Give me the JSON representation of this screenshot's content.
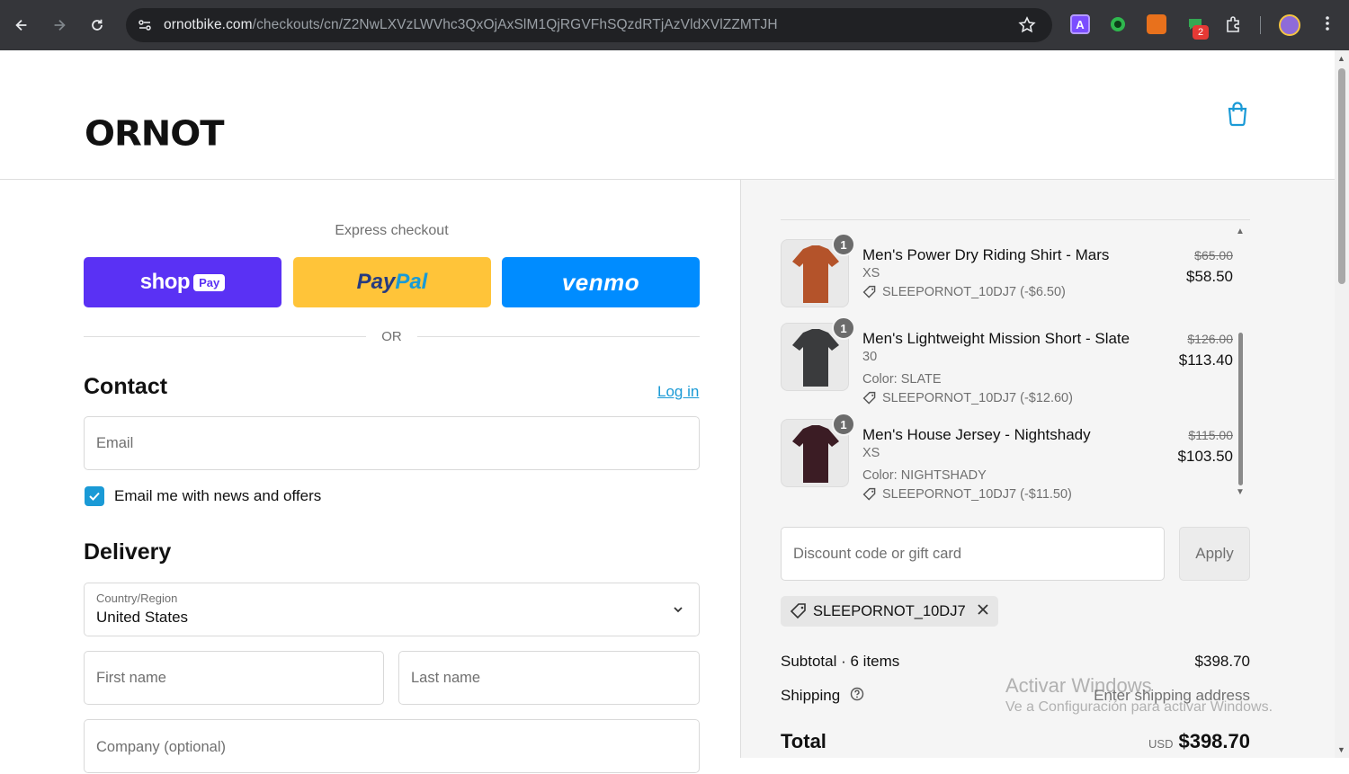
{
  "browser": {
    "url_host": "ornotbike.com",
    "url_path": "/checkouts/cn/Z2NwLXVzLWVhc3QxOjAxSlM1QjRGVFhSQzdRTjAzVldXVlZZMTJH",
    "ext_badge": "2",
    "ext_letter": "A"
  },
  "header": {
    "logo": "ORNOT"
  },
  "express": {
    "label": "Express checkout",
    "shoppay_text": "shop",
    "shoppay_pay": "Pay",
    "paypal_1": "Pay",
    "paypal_2": "Pal",
    "venmo": "venmo",
    "or": "OR"
  },
  "contact": {
    "title": "Contact",
    "login": "Log in",
    "email_placeholder": "Email",
    "newsletter_label": "Email me with news and offers",
    "newsletter_checked": true
  },
  "delivery": {
    "title": "Delivery",
    "country_label": "Country/Region",
    "country_value": "United States",
    "first_name_placeholder": "First name",
    "last_name_placeholder": "Last name",
    "company_placeholder": "Company (optional)"
  },
  "cart": {
    "items": [
      {
        "name": "Men's Power Dry Riding Shirt - Mars",
        "variant": "XS",
        "color": "",
        "discount": "SLEEPORNOT_10DJ7 (-$6.50)",
        "qty": "1",
        "old_price": "$65.00",
        "price": "$58.50",
        "thumb_color": "#b4532a"
      },
      {
        "name": "Men's Lightweight Mission Short - Slate",
        "variant": "30",
        "color": "Color: SLATE",
        "discount": "SLEEPORNOT_10DJ7 (-$12.60)",
        "qty": "1",
        "old_price": "$126.00",
        "price": "$113.40",
        "thumb_color": "#3a3b3d"
      },
      {
        "name": "Men's House Jersey - Nightshady",
        "variant": "XS",
        "color": "Color: NIGHTSHADY",
        "discount": "SLEEPORNOT_10DJ7 (-$11.50)",
        "qty": "1",
        "old_price": "$115.00",
        "price": "$103.50",
        "thumb_color": "#3b1c24"
      }
    ],
    "discount_placeholder": "Discount code or gift card",
    "apply": "Apply",
    "applied_code": "SLEEPORNOT_10DJ7",
    "subtotal_label": "Subtotal · 6 items",
    "subtotal_value": "$398.70",
    "shipping_label": "Shipping",
    "shipping_value": "Enter shipping address",
    "total_label": "Total",
    "total_currency": "USD",
    "total_value": "$398.70"
  },
  "watermark": {
    "line1": "Activar Windows",
    "line2": "Ve a Configuración para activar Windows."
  },
  "colors": {
    "shoppay": "#5a31f4",
    "paypal": "#ffc439",
    "venmo": "#008cff",
    "accent": "#1a9ad6"
  }
}
